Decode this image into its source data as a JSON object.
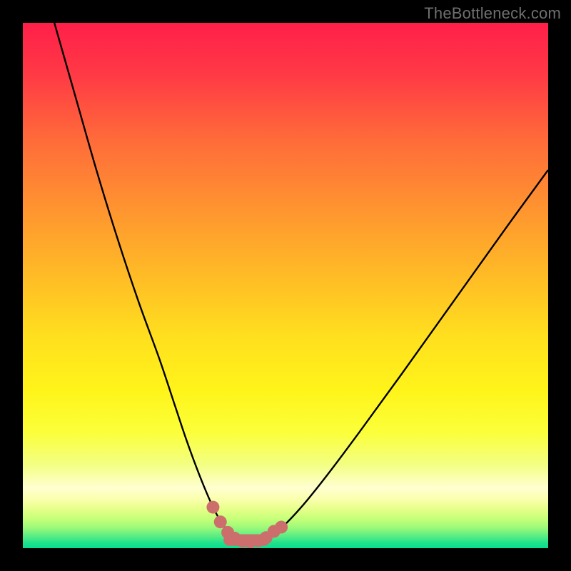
{
  "watermark": "TheBottleneck.com",
  "colors": {
    "black": "#000000",
    "curve": "#000000",
    "marker_fill": "#cc6f6c",
    "marker_stroke": "#b85a57"
  },
  "gradient_stops": [
    {
      "offset": 0.0,
      "color": "#ff1f49"
    },
    {
      "offset": 0.1,
      "color": "#ff3a45"
    },
    {
      "offset": 0.22,
      "color": "#ff6a3a"
    },
    {
      "offset": 0.35,
      "color": "#ff9330"
    },
    {
      "offset": 0.48,
      "color": "#ffbb26"
    },
    {
      "offset": 0.6,
      "color": "#ffe01e"
    },
    {
      "offset": 0.7,
      "color": "#fff41a"
    },
    {
      "offset": 0.78,
      "color": "#fbff3a"
    },
    {
      "offset": 0.84,
      "color": "#f3ff82"
    },
    {
      "offset": 0.885,
      "color": "#ffffd0"
    },
    {
      "offset": 0.905,
      "color": "#fbffb0"
    },
    {
      "offset": 0.925,
      "color": "#e7ff8a"
    },
    {
      "offset": 0.945,
      "color": "#c4ff78"
    },
    {
      "offset": 0.962,
      "color": "#98f97a"
    },
    {
      "offset": 0.978,
      "color": "#56ec84"
    },
    {
      "offset": 0.99,
      "color": "#1fe28c"
    },
    {
      "offset": 1.0,
      "color": "#08dd8f"
    }
  ],
  "chart_data": {
    "type": "line",
    "title": "",
    "xlabel": "",
    "ylabel": "",
    "xlim": [
      0,
      100
    ],
    "ylim": [
      0,
      100
    ],
    "series": [
      {
        "name": "bottleneck-curve",
        "x": [
          6,
          10,
          14,
          18,
          22,
          26,
          29,
          31,
          33,
          35,
          36.5,
          38,
          39.5,
          41,
          43,
          45,
          47,
          49,
          53,
          58,
          64,
          72,
          82,
          92,
          100
        ],
        "y": [
          100,
          86,
          72,
          59,
          47,
          36,
          27,
          21,
          15.5,
          10.5,
          7.2,
          4.6,
          2.7,
          1.6,
          1.2,
          1.3,
          2.0,
          3.6,
          7.8,
          14,
          22,
          33,
          47,
          61,
          72
        ]
      }
    ],
    "markers": {
      "name": "highlight-dots",
      "x": [
        36.2,
        37.6,
        39.0,
        40.3,
        41.8,
        43.3,
        44.8,
        46.3,
        47.8,
        49.2
      ],
      "y": [
        7.8,
        5.0,
        3.0,
        1.9,
        1.3,
        1.2,
        1.4,
        2.0,
        3.2,
        4.0
      ],
      "r": 9
    },
    "marker_bar": {
      "x0": 38.2,
      "x1": 47.0,
      "y": 1.55,
      "thickness_pct": 2.2
    }
  }
}
